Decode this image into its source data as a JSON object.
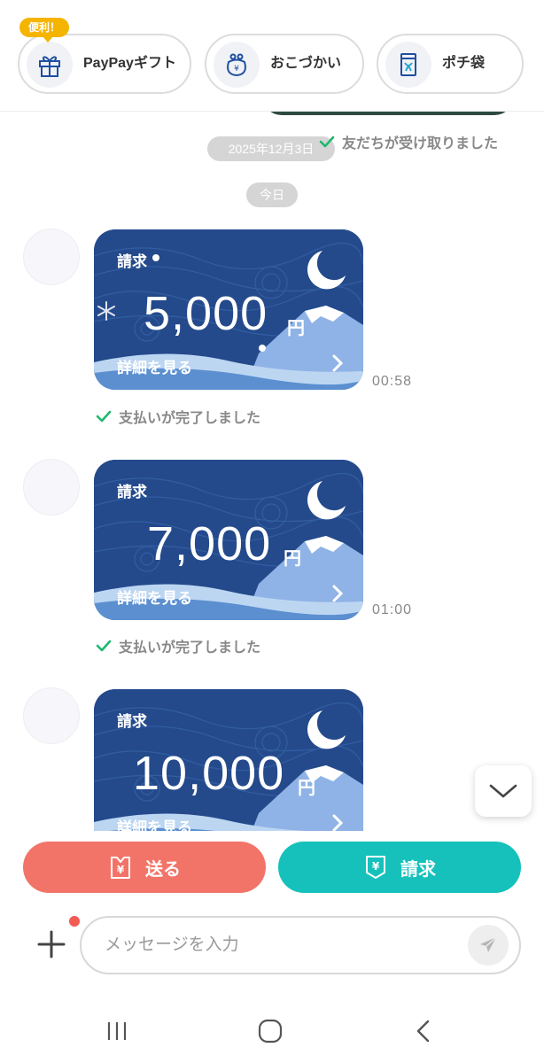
{
  "shortcuts": {
    "badge": "便利！",
    "items": [
      {
        "label": "PayPayギフト",
        "icon": "gift-icon"
      },
      {
        "label": "おこづかい",
        "icon": "purse-icon"
      },
      {
        "label": "ポチ袋",
        "icon": "envelope-icon"
      }
    ]
  },
  "chat": {
    "previous": {
      "date": "2025年12月3日",
      "status": "友だちが受け取りました"
    },
    "today_label": "今日",
    "messages": [
      {
        "title": "請求",
        "amount": "5,000",
        "currency": "円",
        "detail": "詳細を見る",
        "time": "00:58",
        "status": "支払いが完了しました"
      },
      {
        "title": "請求",
        "amount": "7,000",
        "currency": "円",
        "detail": "詳細を見る",
        "time": "01:00",
        "status": "支払いが完了しました"
      },
      {
        "title": "請求",
        "amount": "10,000",
        "currency": "円",
        "detail": "詳細を見る"
      }
    ]
  },
  "actions": {
    "send_label": "送る",
    "request_label": "請求"
  },
  "input": {
    "placeholder": "メッセージを入力"
  },
  "colors": {
    "send": "#f27468",
    "request": "#16c1bb",
    "card": "#244a8c",
    "check": "#1fb86e"
  }
}
